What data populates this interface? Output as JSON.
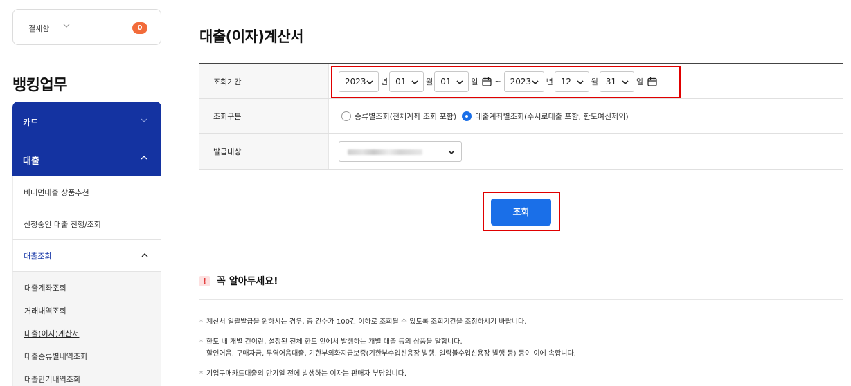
{
  "sidebar": {
    "payment": {
      "label": "결재함",
      "count": "0"
    },
    "section_title": "뱅킹업무",
    "menus": [
      {
        "label": "카드"
      },
      {
        "label": "대출"
      }
    ],
    "sub_items": [
      {
        "label": "비대면대출 상품추천"
      },
      {
        "label": "신청중인 대출 진행/조회"
      },
      {
        "label": "대출조회"
      }
    ],
    "deep_items": [
      {
        "label": "대출계좌조회"
      },
      {
        "label": "거래내역조회"
      },
      {
        "label": "대출(이자)계산서"
      },
      {
        "label": "대출종류별내역조회"
      },
      {
        "label": "대출만기내역조회"
      }
    ]
  },
  "main": {
    "title": "대출(이자)계산서",
    "form": {
      "period_label": "조회기간",
      "start": {
        "year": "2023",
        "month": "01",
        "day": "01"
      },
      "end": {
        "year": "2023",
        "month": "12",
        "day": "31"
      },
      "unit_year": "년",
      "unit_month": "월",
      "unit_day": "일",
      "tilde": "~",
      "type_label": "조회구분",
      "type_options": [
        {
          "label": "종류별조회(전체계좌 조회 포함)",
          "selected": false
        },
        {
          "label": "대출계좌별조회(수시로대출 포함, 한도여신제외)",
          "selected": true
        }
      ],
      "issue_label": "발급대상"
    },
    "search_button": "조회",
    "notice": {
      "mark": "!",
      "title": "꼭 알아두세요!",
      "items": [
        {
          "line1": "계산서 일괄발급을 원하시는 경우, 총 건수가 100건 이하로 조회될 수 있도록 조회기간을 조정하시기 바랍니다.",
          "line2": ""
        },
        {
          "line1": "한도 내 개별 건이란, 설정된 전체 한도 안에서 발생하는 개별 대출 등의 상품을 말합니다.",
          "line2": "할인어음, 구매자금, 무역어음대출, 기한부외화지급보증(기한부수입신용장 발행, 일람불수입신용장 발행 등) 등이 이에 속합니다."
        },
        {
          "line1": "기업구매카드대출의 만기일 전에 발생하는 이자는 판매자 부담입니다.",
          "line2": ""
        }
      ]
    }
  },
  "colors": {
    "primary": "#1433a1",
    "button": "#1a6fe8",
    "highlight": "#e00000",
    "badge": "#f26b3a"
  }
}
